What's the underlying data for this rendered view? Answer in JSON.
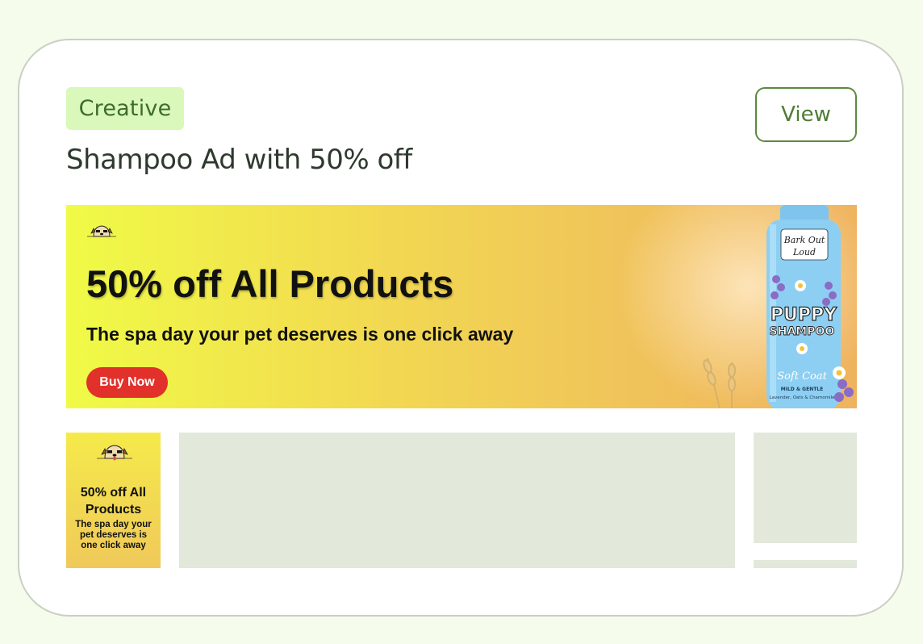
{
  "card": {
    "tag": "Creative",
    "view_button": "View",
    "title": "Shampoo Ad with 50% off"
  },
  "banner": {
    "headline": "50% off All Products",
    "subheadline": "The spa day your pet deserves is one click away",
    "cta": "Buy Now",
    "product": {
      "brand_line1": "Bark Out",
      "brand_line2": "Loud",
      "name_line1": "PUPPY",
      "name_line2": "SHAMPOO",
      "variant": "Soft Coat",
      "tagline": "MILD & GENTLE",
      "ingredients": "Lavender, Oats & Chamomile"
    },
    "icons": [
      "dog-logo-icon"
    ],
    "colors": {
      "cta": "#e2312a",
      "gradient_start": "#f0fb46",
      "gradient_end": "#efb35f"
    }
  },
  "mini_ad": {
    "headline": "50% off All Products",
    "subheadline": "The spa day your pet deserves is one click away"
  },
  "colors": {
    "page_bg": "#f5fcec",
    "tag_bg": "#d9f8b9",
    "accent": "#4d7c34",
    "placeholder": "#e2e8da"
  }
}
